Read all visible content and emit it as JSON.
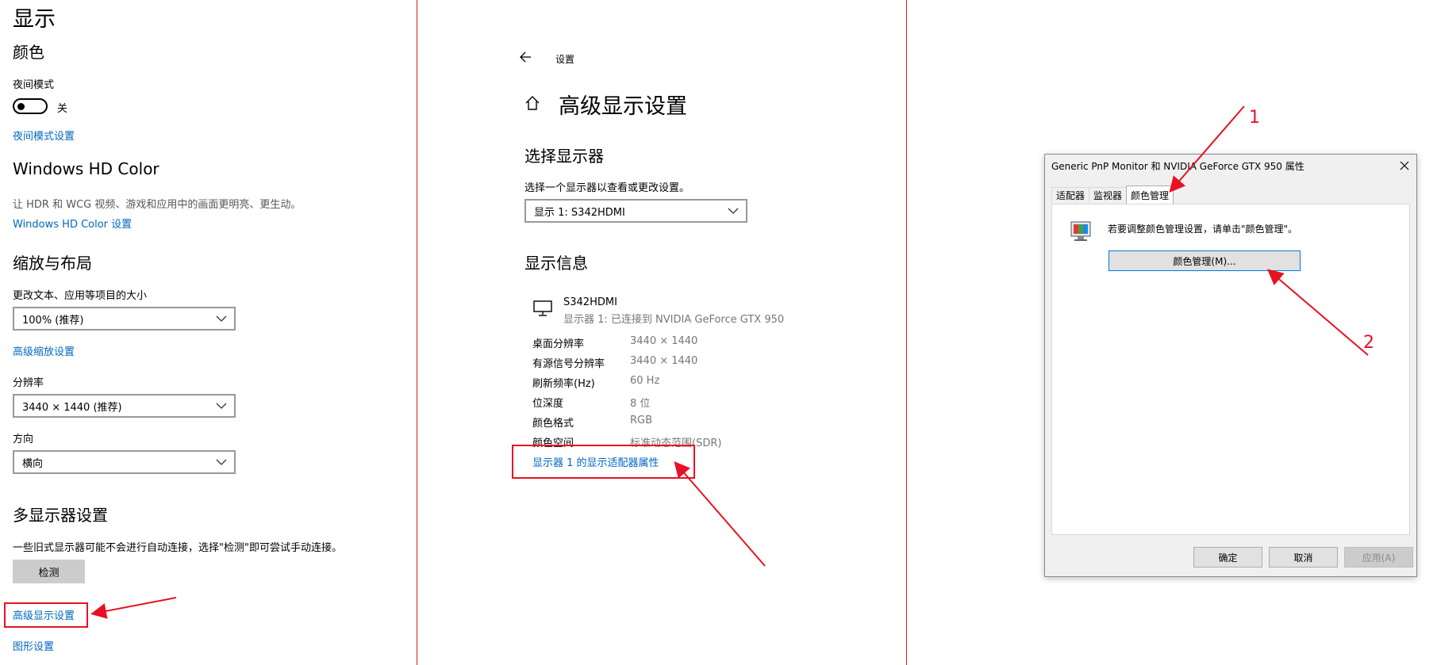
{
  "left": {
    "title": "显示",
    "color_header": "颜色",
    "night_mode_label": "夜间模式",
    "night_toggle_state": "关",
    "night_settings_link": "夜间模式设置",
    "hdr_header": "Windows HD Color",
    "hdr_desc": "让 HDR 和 WCG 视频、游戏和应用中的画面更明亮、更生动。",
    "hdr_link": "Windows HD Color 设置",
    "scale_header": "缩放与布局",
    "scale_label": "更改文本、应用等项目的大小",
    "scale_value": "100% (推荐)",
    "adv_scale_link": "高级缩放设置",
    "resolution_label": "分辨率",
    "resolution_value": "3440 × 1440 (推荐)",
    "orientation_label": "方向",
    "orientation_value": "横向",
    "multi_header": "多显示器设置",
    "multi_desc": "一些旧式显示器可能不会进行自动连接，选择\"检测\"即可尝试手动连接。",
    "detect_button": "检测",
    "adv_display_link": "高级显示设置",
    "graphics_link": "图形设置"
  },
  "middle": {
    "back_label": "设置",
    "title": "高级显示设置",
    "choose_header": "选择显示器",
    "choose_desc": "选择一个显示器以查看或更改设置。",
    "display_select": "显示 1: S342HDMI",
    "info_header": "显示信息",
    "monitor_name": "S342HDMI",
    "monitor_sub": "显示器 1: 已连接到 NVIDIA GeForce GTX 950",
    "rows": [
      {
        "label": "桌面分辨率",
        "value": "3440 × 1440"
      },
      {
        "label": "有源信号分辨率",
        "value": "3440 × 1440"
      },
      {
        "label": "刷新频率(Hz)",
        "value": "60 Hz"
      },
      {
        "label": "位深度",
        "value": "8 位"
      },
      {
        "label": "颜色格式",
        "value": "RGB"
      },
      {
        "label": "颜色空间",
        "value": "标准动态范围(SDR)"
      }
    ],
    "adapter_link": "显示器 1 的显示适配器属性"
  },
  "dialog": {
    "title": "Generic PnP Monitor 和 NVIDIA GeForce GTX 950 属性",
    "tabs": [
      "适配器",
      "监视器",
      "颜色管理"
    ],
    "info_text": "若要调整颜色管理设置，请单击\"颜色管理\"。",
    "color_mgmt_button": "颜色管理(M)...",
    "ok_button": "确定",
    "cancel_button": "取消",
    "apply_button": "应用(A)"
  },
  "annotations": {
    "one": "1",
    "two": "2"
  },
  "colors": {
    "accent": "#0067c0",
    "red": "#e81123"
  }
}
